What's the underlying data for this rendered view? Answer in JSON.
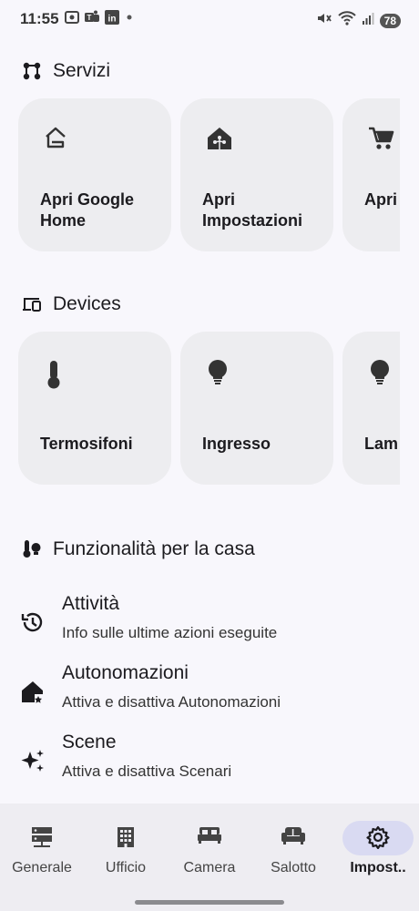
{
  "status": {
    "time": "11:55",
    "battery": "78",
    "left_icons": [
      "screenshot-icon",
      "teams-icon",
      "linkedin-icon",
      "dot-icon"
    ],
    "right_icons": [
      "mute-icon",
      "wifi-icon",
      "signal-icon"
    ]
  },
  "sections": {
    "services": {
      "title": "Servizi",
      "icon": "services-icon"
    },
    "devices": {
      "title": "Devices",
      "icon": "devices-icon"
    },
    "features": {
      "title": "Funzionalità per la casa",
      "icon": "home-features-icon"
    }
  },
  "services": [
    {
      "label": "Apri Google Home",
      "icon": "google-home-icon"
    },
    {
      "label": "Apri Impostazioni",
      "icon": "home-settings-icon"
    },
    {
      "label": "Apri della",
      "icon": "cart-icon"
    }
  ],
  "devices": [
    {
      "label": "Termosifoni",
      "icon": "thermometer-icon"
    },
    {
      "label": "Ingresso",
      "icon": "lightbulb-icon"
    },
    {
      "label": "Lam",
      "icon": "lightbulb-icon"
    }
  ],
  "features": [
    {
      "title": "Attività",
      "subtitle": "Info sulle ultime azioni eseguite",
      "icon": "history-icon"
    },
    {
      "title": "Autonomazioni",
      "subtitle": "Attiva e disattiva Autonomazioni",
      "icon": "automation-icon"
    },
    {
      "title": "Scene",
      "subtitle": "Attiva e disattiva Scenari",
      "icon": "sparkle-icon"
    }
  ],
  "nav": [
    {
      "label": "Generale",
      "icon": "server-icon",
      "active": false
    },
    {
      "label": "Ufficio",
      "icon": "building-icon",
      "active": false
    },
    {
      "label": "Camera",
      "icon": "bed-icon",
      "active": false
    },
    {
      "label": "Salotto",
      "icon": "sofa-icon",
      "active": false
    },
    {
      "label": "Impost..",
      "icon": "gear-icon",
      "active": true
    }
  ]
}
